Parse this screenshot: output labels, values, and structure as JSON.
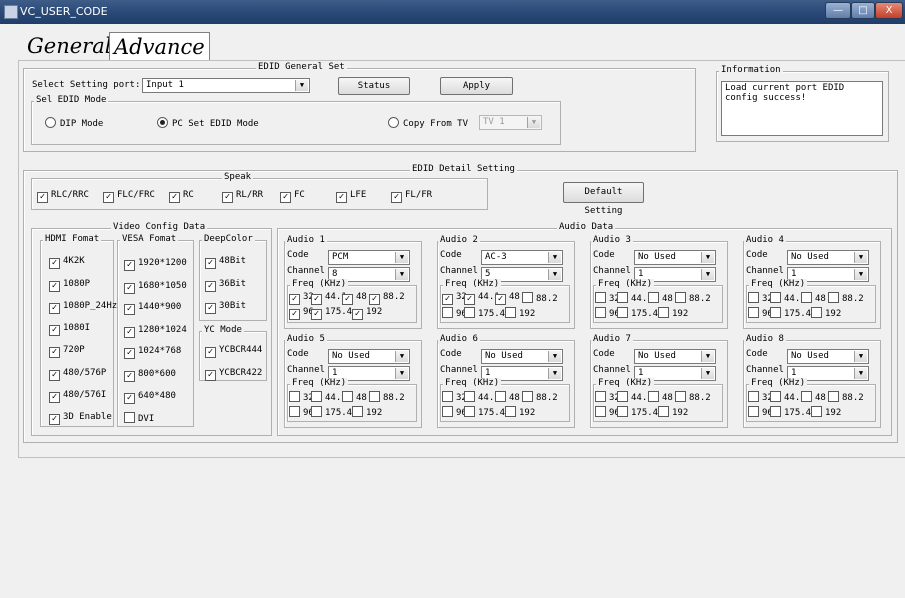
{
  "window": {
    "title": "VC_USER_CODE",
    "min": "—",
    "max": "□",
    "close": "X"
  },
  "tabs": [
    {
      "label": "General",
      "active": false
    },
    {
      "label": "Advance",
      "active": true
    }
  ],
  "general_set": {
    "title": "EDID General Set",
    "port_label": "Select Setting port:",
    "port_value": "Input 1",
    "status_label": "Status",
    "apply_label": "Apply",
    "mode_group_title": "Sel EDID  Mode",
    "mode_dip": "DIP Mode",
    "mode_pc": "PC Set EDID Mode",
    "mode_tv": "Copy From TV",
    "mode_selected": "pc",
    "tv_value": "TV 1"
  },
  "information": {
    "title": "Information",
    "text": "Load current port EDID config success!"
  },
  "detail": {
    "title": "EDID Detail Setting",
    "default_label": "Default Setting",
    "speak": {
      "title": "Speak",
      "items": [
        {
          "label": "RLC/RRC",
          "checked": true
        },
        {
          "label": "FLC/FRC",
          "checked": true
        },
        {
          "label": "RC",
          "checked": true
        },
        {
          "label": "RL/RR",
          "checked": true
        },
        {
          "label": "FC",
          "checked": true
        },
        {
          "label": "LFE",
          "checked": true
        },
        {
          "label": "FL/FR",
          "checked": true
        }
      ]
    },
    "video": {
      "title": "Video Config Data",
      "hdmi": {
        "title": "HDMI Fomat",
        "items": [
          {
            "label": "4K2K",
            "checked": true
          },
          {
            "label": "1080P",
            "checked": true
          },
          {
            "label": "1080P_24Hz",
            "checked": true
          },
          {
            "label": "1080I",
            "checked": true
          },
          {
            "label": "720P",
            "checked": true
          },
          {
            "label": "480/576P",
            "checked": true
          },
          {
            "label": "480/576I",
            "checked": true
          },
          {
            "label": "3D Enable",
            "checked": true
          }
        ]
      },
      "vesa": {
        "title": "VESA Fomat",
        "items": [
          {
            "label": "1920*1200",
            "checked": true
          },
          {
            "label": "1680*1050",
            "checked": true
          },
          {
            "label": "1440*900",
            "checked": true
          },
          {
            "label": "1280*1024",
            "checked": true
          },
          {
            "label": "1024*768",
            "checked": true
          },
          {
            "label": "800*600",
            "checked": true
          },
          {
            "label": "640*480",
            "checked": true
          },
          {
            "label": "DVI",
            "checked": false
          }
        ]
      },
      "deepcolor": {
        "title": "DeepColor",
        "items": [
          {
            "label": "48Bit",
            "checked": true
          },
          {
            "label": "36Bit",
            "checked": true
          },
          {
            "label": "30Bit",
            "checked": true
          }
        ]
      },
      "ycmode": {
        "title": "YC Mode",
        "items": [
          {
            "label": "YCBCR444",
            "checked": true
          },
          {
            "label": "YCBCR422",
            "checked": true
          }
        ]
      }
    },
    "audio": {
      "title": "Audio Data",
      "code_label": "Code",
      "channel_label": "Channel",
      "freq_label": "Freq (KHz)",
      "freq_names": [
        "32",
        "44.1",
        "48",
        "88.2",
        "96",
        "175.4",
        "192"
      ],
      "blocks": [
        {
          "title": "Audio 1",
          "code": "PCM",
          "channel": "8",
          "freq": [
            true,
            true,
            true,
            true,
            true,
            true,
            true
          ]
        },
        {
          "title": "Audio 2",
          "code": "AC-3",
          "channel": "5",
          "freq": [
            true,
            true,
            true,
            false,
            false,
            false,
            false
          ]
        },
        {
          "title": "Audio 3",
          "code": "No Used",
          "channel": "1",
          "freq": [
            false,
            false,
            false,
            false,
            false,
            false,
            false
          ]
        },
        {
          "title": "Audio 4",
          "code": "No Used",
          "channel": "1",
          "freq": [
            false,
            false,
            false,
            false,
            false,
            false,
            false
          ]
        },
        {
          "title": "Audio 5",
          "code": "No Used",
          "channel": "1",
          "freq": [
            false,
            false,
            false,
            false,
            false,
            false,
            false
          ]
        },
        {
          "title": "Audio 6",
          "code": "No Used",
          "channel": "1",
          "freq": [
            false,
            false,
            false,
            false,
            false,
            false,
            false
          ]
        },
        {
          "title": "Audio 7",
          "code": "No Used",
          "channel": "1",
          "freq": [
            false,
            false,
            false,
            false,
            false,
            false,
            false
          ]
        },
        {
          "title": "Audio 8",
          "code": "No Used",
          "channel": "1",
          "freq": [
            false,
            false,
            false,
            false,
            false,
            false,
            false
          ]
        }
      ]
    }
  }
}
